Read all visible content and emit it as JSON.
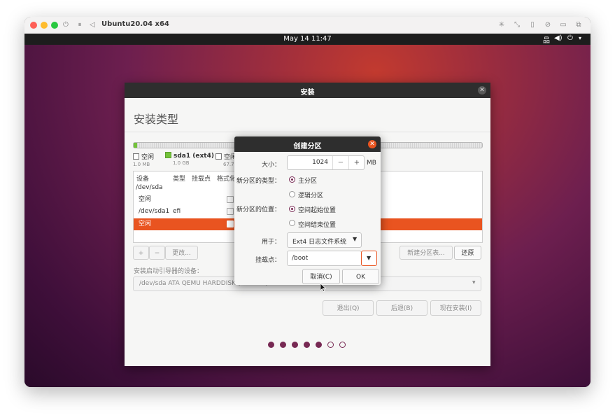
{
  "vm": {
    "name": "Ubuntu20.04 x64"
  },
  "topbar": {
    "clock": "May 14  11:47"
  },
  "installer": {
    "title": "安装",
    "page_title": "安装类型",
    "legend": [
      {
        "name": "空闲",
        "size": "1.0 MB",
        "color": "#ffffff"
      },
      {
        "name": "sda1 (ext4)",
        "size": "1.0 GB",
        "color": "#73c33a"
      },
      {
        "name": "空闲",
        "size": "67.7",
        "color": "#ffffff"
      }
    ],
    "table": {
      "headers": [
        "设备",
        "类型",
        "挂载点",
        "格式化"
      ],
      "rows": [
        {
          "device": "/dev/sda",
          "type": "",
          "selected": false
        },
        {
          "device": "空闲",
          "type": "",
          "selected": false
        },
        {
          "device": "/dev/sda1",
          "type": "efi",
          "selected": false
        },
        {
          "device": "空闲",
          "type": "",
          "selected": true
        }
      ]
    },
    "buttons": {
      "add": "+",
      "remove": "−",
      "change": "更改...",
      "new_table": "新建分区表...",
      "revert": "还原"
    },
    "boot_label": "安装启动引导器的设备：",
    "boot_device": "/dev/sda   ATA QEMU HARDDISK (68.7 GB)",
    "nav": {
      "quit": "退出(Q)",
      "back": "后退(B)",
      "install": "现在安装(I)"
    },
    "progress": {
      "total": 7,
      "done": 5
    }
  },
  "dialog": {
    "title": "创建分区",
    "size_label": "大小：",
    "size_value": "1024",
    "size_unit": "MB",
    "minus": "−",
    "plus": "+",
    "type_label": "新分区的类型：",
    "type_options": [
      "主分区",
      "逻辑分区"
    ],
    "type_selected": 0,
    "location_label": "新分区的位置：",
    "location_options": [
      "空间起始位置",
      "空间结束位置"
    ],
    "location_selected": 0,
    "use_label": "用于：",
    "use_value": "Ext4 日志文件系统",
    "mount_label": "挂载点：",
    "mount_value": "/boot",
    "cancel": "取消(C)",
    "ok": "OK"
  },
  "colors": {
    "accent": "#e95420",
    "aubergine": "#772953",
    "green": "#73c33a"
  }
}
